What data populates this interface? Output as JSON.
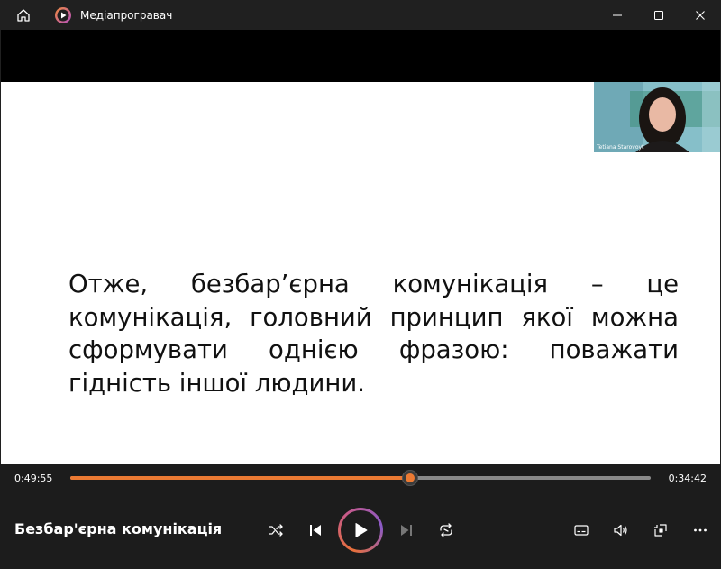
{
  "window": {
    "title": "Медіапрогравач"
  },
  "slide": {
    "text": "Отже, безбар’єрна комунікація – це комунікація, головний принцип якої можна сформувати однією фразою: поважати гідність іншої людини."
  },
  "webcam": {
    "name": "Tetiana Starovoyt"
  },
  "player": {
    "elapsed": "0:49:55",
    "remaining": "0:34:42",
    "progress": 0.585,
    "media_title": "Безбар'єрна комунікація",
    "accent_color": "#ec7a33"
  },
  "icons": {
    "home": "home-icon",
    "app": "media-player-icon",
    "minimize": "minimize-icon",
    "maximize": "maximize-icon",
    "close": "close-icon",
    "shuffle": "shuffle-icon",
    "previous": "previous-icon",
    "play": "play-icon",
    "next": "next-icon",
    "repeat": "repeat-icon",
    "subtitles": "subtitles-icon",
    "volume": "volume-icon",
    "miniplayer": "miniplayer-icon",
    "more": "more-icon"
  }
}
